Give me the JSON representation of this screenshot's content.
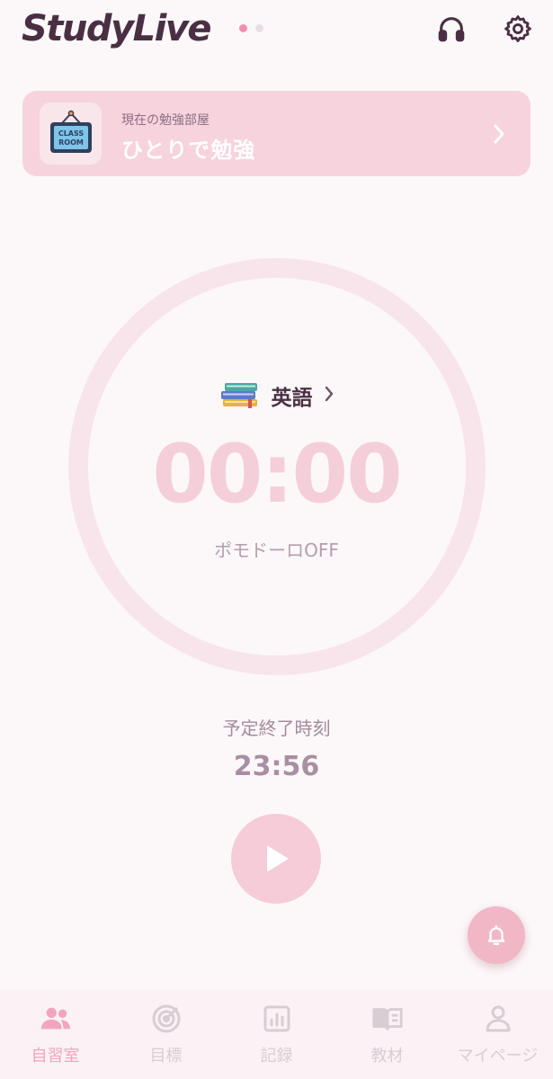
{
  "header": {
    "brand": "StudyLive",
    "page_dots": 2,
    "active_dot": 0,
    "icons": [
      "headphones-icon",
      "gear-icon"
    ]
  },
  "room": {
    "subtitle": "現在の勉強部屋",
    "title": "ひとりで勉強",
    "thumb_text_line1": "CLASS",
    "thumb_text_line2": "ROOM"
  },
  "timer": {
    "subject_icon": "books-icon",
    "subject": "英語",
    "time": "00:00",
    "pomodoro": "ポモドーロOFF",
    "end_label": "予定終了時刻",
    "end_time": "23:56"
  },
  "nav": {
    "items": [
      {
        "label": "自習室",
        "icon": "users-icon",
        "active": true
      },
      {
        "label": "目標",
        "icon": "target-icon",
        "active": false
      },
      {
        "label": "記録",
        "icon": "chart-icon",
        "active": false
      },
      {
        "label": "教材",
        "icon": "book-icon",
        "active": false
      },
      {
        "label": "マイページ",
        "icon": "person-icon",
        "active": false
      }
    ]
  },
  "colors": {
    "accent": "#f2a5bc",
    "card": "#f7d3dd",
    "ring": "#f8e5eb",
    "text_dark": "#4a2f44"
  }
}
